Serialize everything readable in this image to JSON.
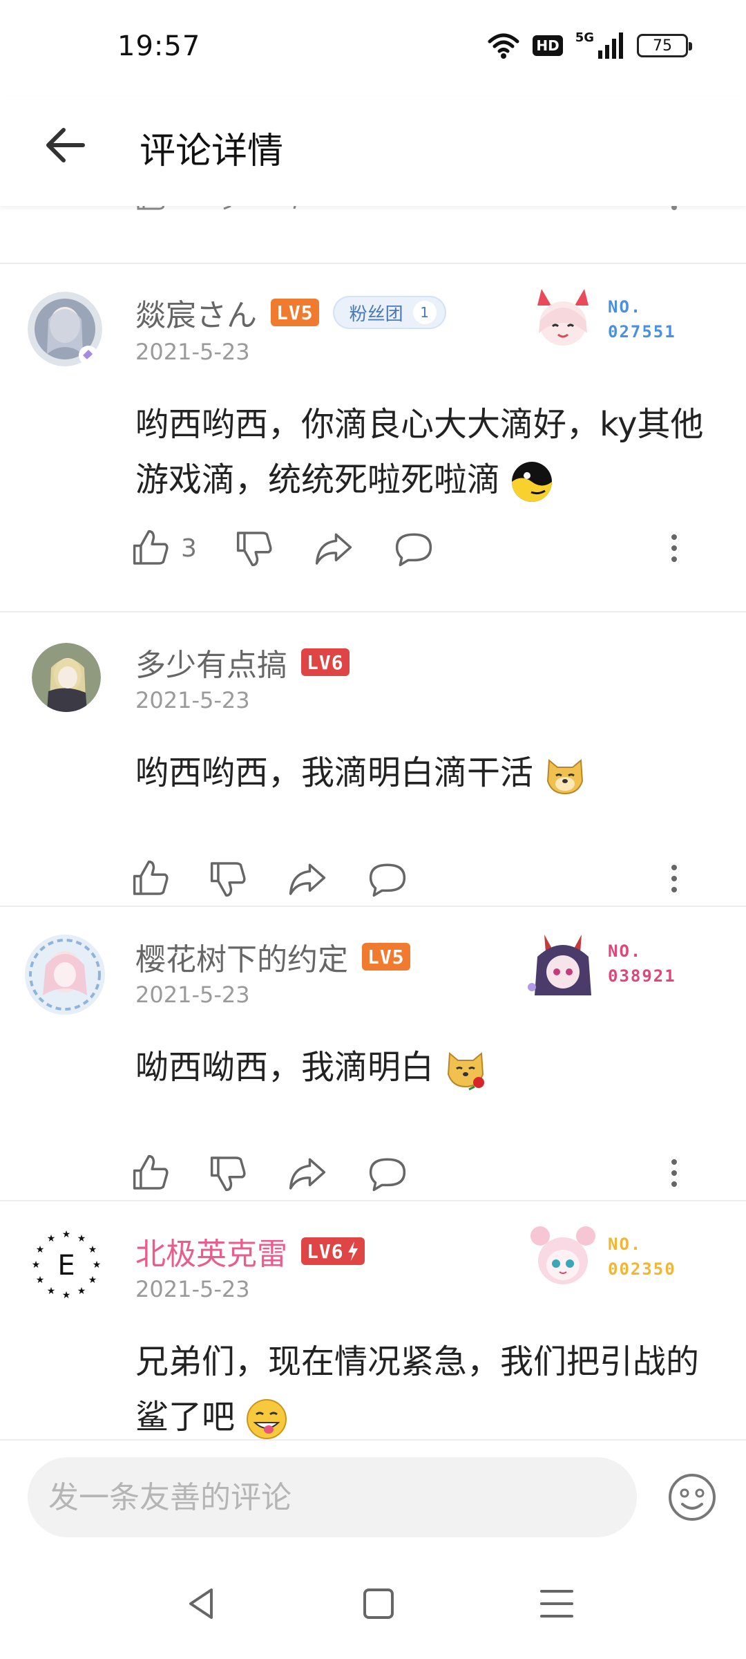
{
  "status_bar": {
    "time": "19:57",
    "network": "5G",
    "hd": "HD",
    "battery": "75",
    "icons": [
      "wifi-icon",
      "hd-icon",
      "signal-icon",
      "battery-icon"
    ]
  },
  "header": {
    "title": "评论详情",
    "back_icon": "back-arrow-icon"
  },
  "comments": [
    {
      "username": "燚宸さん",
      "level": "LV5",
      "fans_label": "粉丝团",
      "fans_level": "1",
      "date": "2021-5-23",
      "content": "哟西哟西，你滴良心大大滴好，ky其他游戏滴，统统死啦死啦滴",
      "emoji": "yin-yang-face-emoji",
      "likes": "3",
      "badge_no_label": "NO.",
      "badge_no": "027551",
      "badge_color": "#4a90e2"
    },
    {
      "username": "多少有点搞",
      "level": "LV6",
      "date": "2021-5-23",
      "content": "哟西哟西，我滴明白滴干活",
      "emoji": "doge-emoji",
      "likes": ""
    },
    {
      "username": "樱花树下的约定",
      "level": "LV5",
      "date": "2021-5-23",
      "content": "呦西呦西，我滴明白",
      "emoji": "doge-rose-emoji",
      "likes": "",
      "badge_no_label": "NO.",
      "badge_no": "038921",
      "badge_color": "#e0467a"
    },
    {
      "username": "北极英克雷",
      "level": "LV6",
      "date": "2021-5-23",
      "content": "兄弟们，现在情况紧急，我们把引战的鲨了吧",
      "emoji": "tongue-smile-emoji",
      "likes": "",
      "badge_no_label": "NO.",
      "badge_no": "002350",
      "badge_color": "#f2b631"
    }
  ],
  "input": {
    "placeholder": "发一条友善的评论",
    "emoji_icon": "smiley-icon"
  },
  "nav": [
    "back-triangle-icon",
    "home-square-icon",
    "menu-lines-icon"
  ]
}
